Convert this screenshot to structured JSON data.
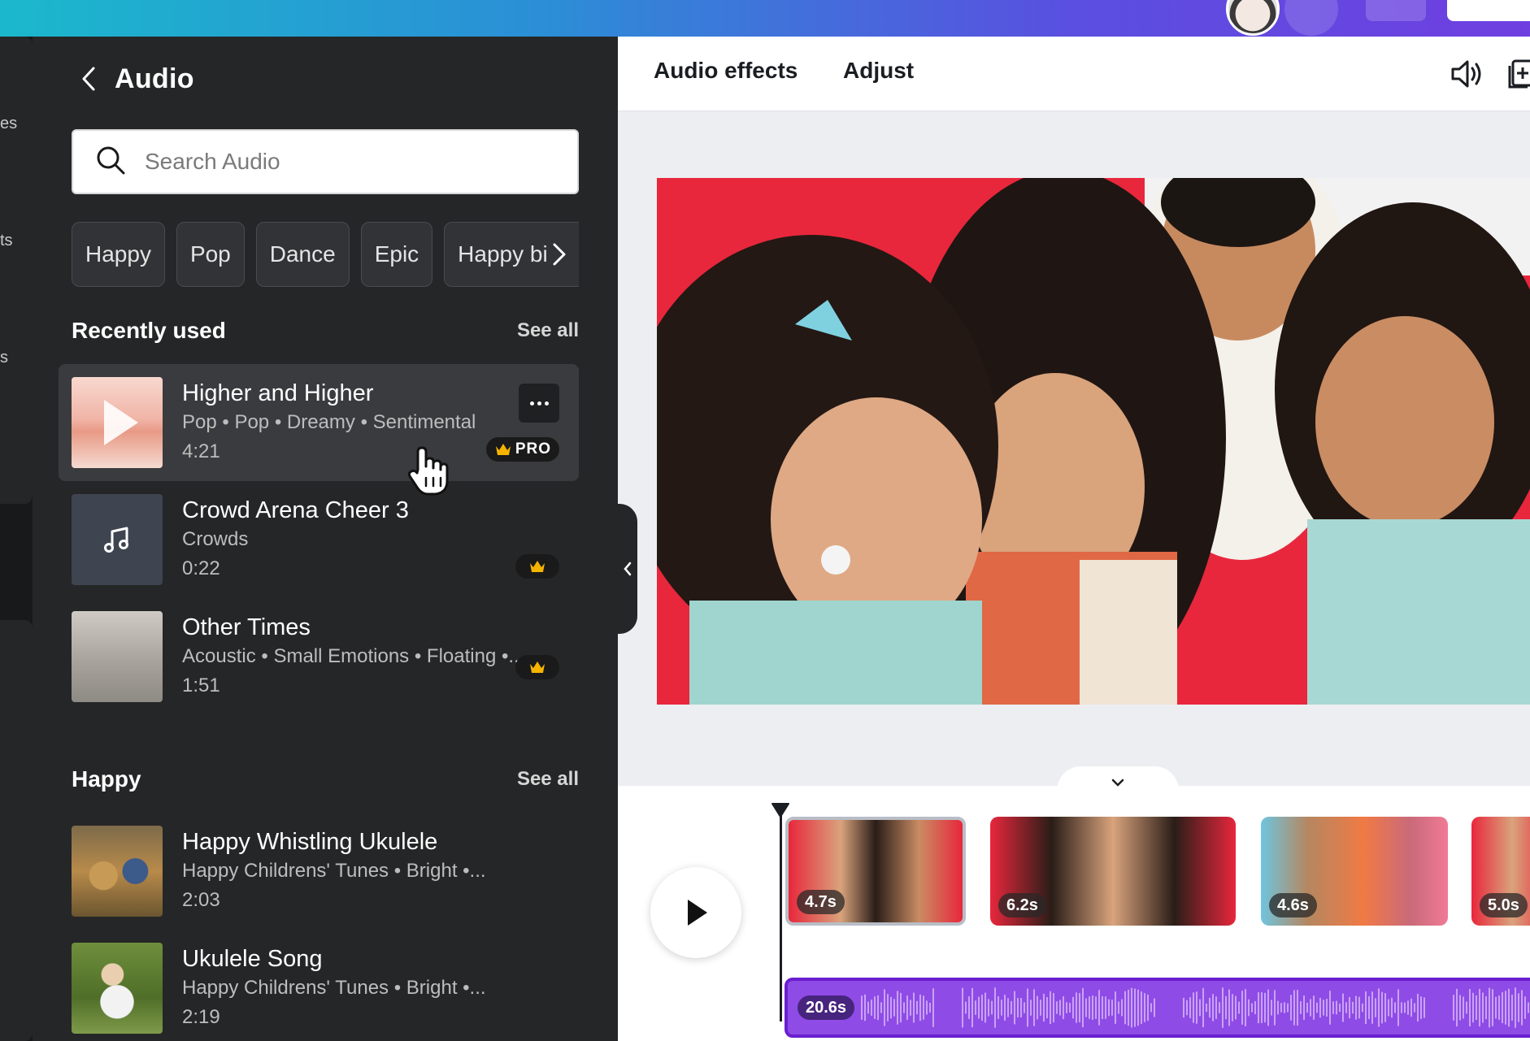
{
  "rail": {
    "fragments": [
      "es",
      "ts",
      "s"
    ]
  },
  "panel": {
    "title": "Audio",
    "search": {
      "placeholder": "Search Audio",
      "value": ""
    },
    "chips": [
      "Happy",
      "Pop",
      "Dance",
      "Epic",
      "Happy bi"
    ],
    "recently_used": {
      "title": "Recently used",
      "see_all": "See all",
      "tracks": [
        {
          "title": "Higher and Higher",
          "meta": "Pop • Pop • Dreamy • Sentimental",
          "duration": "4:21",
          "badge": "PRO"
        },
        {
          "title": "Crowd Arena Cheer 3",
          "meta": "Crowds",
          "duration": "0:22"
        },
        {
          "title": "Other Times",
          "meta": "Acoustic • Small Emotions • Floating •...",
          "duration": "1:51"
        }
      ]
    },
    "happy": {
      "title": "Happy",
      "see_all": "See all",
      "tracks": [
        {
          "title": "Happy Whistling Ukulele",
          "meta": "Happy Childrens' Tunes • Bright •...",
          "duration": "2:03"
        },
        {
          "title": "Ukulele Song",
          "meta": "Happy Childrens' Tunes • Bright •...",
          "duration": "2:19"
        }
      ]
    }
  },
  "toolbar": {
    "audio_effects": "Audio effects",
    "adjust": "Adjust"
  },
  "timeline": {
    "clips": [
      "4.7s",
      "6.2s",
      "4.6s",
      "5.0s"
    ],
    "audio_duration": "20.6s"
  },
  "colors": {
    "accent": "#8f4be6",
    "panel_bg": "#252627",
    "crown": "#f5b400"
  }
}
